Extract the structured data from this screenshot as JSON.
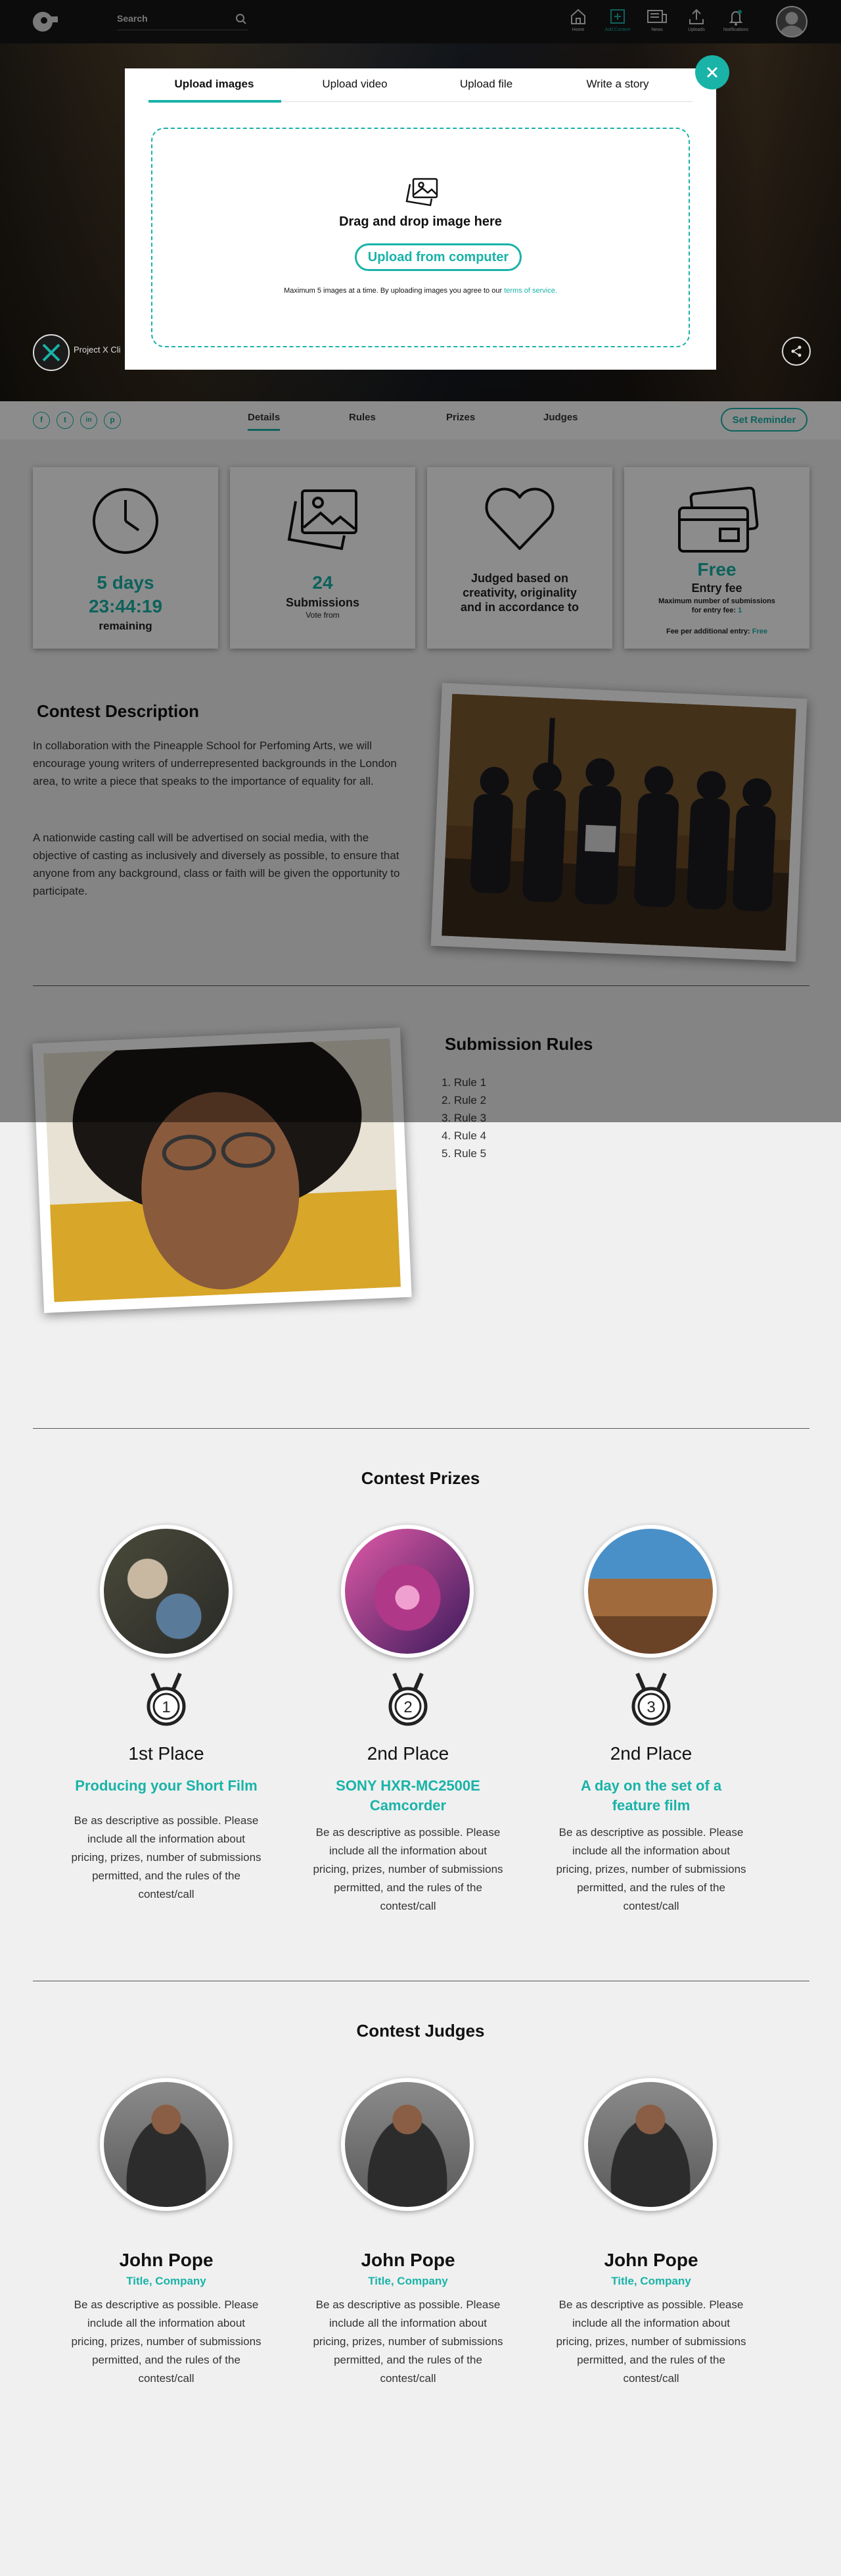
{
  "header": {
    "search_placeholder": "Search",
    "nav": [
      {
        "label": "Home",
        "icon": "home-icon"
      },
      {
        "label": "Add Content",
        "icon": "add-content-icon"
      },
      {
        "label": "News",
        "icon": "news-icon"
      },
      {
        "label": "Uploads",
        "icon": "upload-icon"
      },
      {
        "label": "Notifications",
        "icon": "bell-icon"
      }
    ]
  },
  "hero": {
    "name": "Project X Cli"
  },
  "tabs": {
    "social": [
      "f",
      "t",
      "in",
      "p"
    ],
    "items": [
      "Details",
      "Rules",
      "Prizes",
      "Judges"
    ],
    "reminder": "Set Reminder"
  },
  "stats": {
    "time": {
      "days": "5 days",
      "clock": "23:44:19",
      "label": "remaining"
    },
    "submissions": {
      "count": "24",
      "label": "Submissions",
      "sub": "Vote from"
    },
    "judging": {
      "text": [
        "Judged based on",
        "creativity, originality",
        "and in accordance to"
      ]
    },
    "fee": {
      "price": "Free",
      "label": "Entry fee",
      "max_line1": "Maximum number of submissions",
      "max_line2": "for entry fee:",
      "max_value": "1",
      "additional": "Fee per additional entry:",
      "additional_value": "Free"
    }
  },
  "description": {
    "title": "Contest Description",
    "p1": "In collaboration with the Pineapple School for Perfoming Arts, we will encourage young writers of underrepresented backgrounds in the London area, to write a piece that speaks to the importance of equality for all.",
    "p2": "A nationwide casting call will be advertised on social media, with the objective of casting as inclusively and diversely as possible, to ensure that anyone from any background, class or faith will be given the opportunity to participate."
  },
  "rules": {
    "title": "Submission Rules",
    "items": [
      "1. Rule 1",
      "2. Rule 2",
      "3. Rule 3",
      "4. Rule 4",
      "5. Rule 5"
    ]
  },
  "modal": {
    "tabs": [
      "Upload images",
      "Upload video",
      "Upload file",
      "Write a story"
    ],
    "drop_title": "Drag and drop image here",
    "upload_button": "Upload from computer",
    "note": "Maximum 5 images at a time. By uploading images you agree to our",
    "terms_link": "terms of service."
  },
  "prizes": {
    "title": "Contest Prizes",
    "items": [
      {
        "medal": "1",
        "place": "1st Place",
        "name": "Producing your Short Film",
        "desc": "Be as descriptive as possible. Please include all the information about pricing, prizes, number of submissions permitted, and the rules of the contest/call"
      },
      {
        "medal": "2",
        "place": "2nd Place",
        "name": "SONY HXR-MC2500E Camcorder",
        "desc": "Be as descriptive as possible. Please include all the information about pricing, prizes, number of submissions permitted, and the rules of the contest/call"
      },
      {
        "medal": "3",
        "place": "2nd Place",
        "name": "A day on the set of a feature film",
        "desc": "Be as descriptive as possible. Please include all the information about pricing, prizes, number of submissions permitted, and the rules of the contest/call"
      }
    ]
  },
  "judges": {
    "title": "Contest Judges",
    "items": [
      {
        "name": "John Pope",
        "title": "Title, Company",
        "desc": "Be as descriptive as possible. Please include all the information about pricing, prizes, number of submissions permitted, and the rules of the contest/call"
      },
      {
        "name": "John Pope",
        "title": "Title, Company",
        "desc": "Be as descriptive as possible. Please include all the information about pricing, prizes, number of submissions permitted, and the rules of the contest/call"
      },
      {
        "name": "John Pope",
        "title": "Title, Company",
        "desc": "Be as descriptive as possible. Please include all the information about pricing, prizes, number of submissions permitted, and the rules of the contest/call"
      }
    ]
  },
  "colors": {
    "accent": "#19b3a8",
    "header": "#161616",
    "page": "#f0f0f0"
  }
}
